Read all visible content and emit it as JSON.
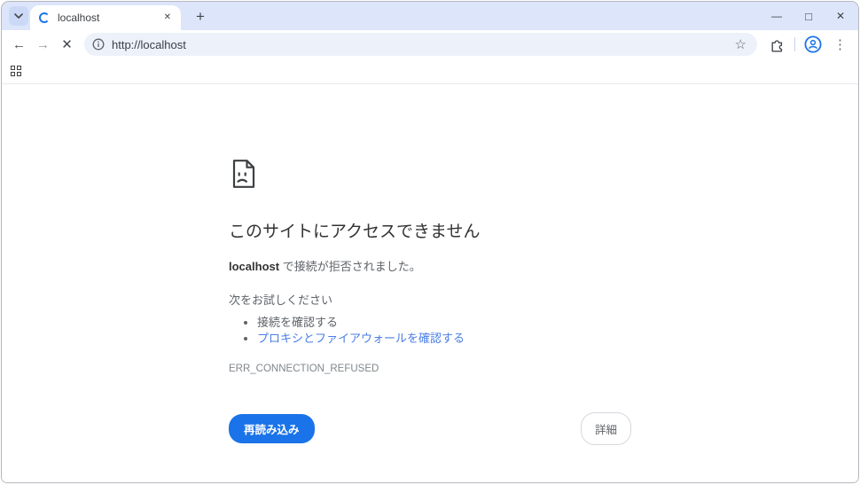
{
  "window": {
    "tab": {
      "title": "localhost"
    },
    "controls": {
      "minimize": "—",
      "maximize": "□",
      "close": "✕"
    },
    "new_tab_label": "+",
    "tab_close_label": "✕"
  },
  "toolbar": {
    "back": "←",
    "forward": "→",
    "stop": "✕",
    "url": "http://localhost",
    "star": "☆",
    "menu_dots": "⋮"
  },
  "error_page": {
    "title": "このサイトにアクセスできません",
    "message_host": "localhost",
    "message_rest": " で接続が拒否されました。",
    "suggestions_title": "次をお試しください",
    "suggestions": [
      {
        "label": "接続を確認する"
      },
      {
        "label": "プロキシとファイアウォールを確認する"
      }
    ],
    "error_code": "ERR_CONNECTION_REFUSED",
    "reload_button": "再読み込み",
    "details_button": "詳細"
  },
  "icons": {
    "favicon": "loading-spinner",
    "info": "info-circle",
    "extensions": "puzzle-piece",
    "profile": "person-circle",
    "apps": "grid-2x2"
  },
  "colors": {
    "accent_blue": "#1a73e8",
    "link_blue": "#4a7de8",
    "tabstrip_bg": "#dce5fa",
    "omnibox_bg": "#edf1fa",
    "text_dark": "#333333",
    "text_gray": "#5f6368",
    "error_code_gray": "#80868b"
  }
}
